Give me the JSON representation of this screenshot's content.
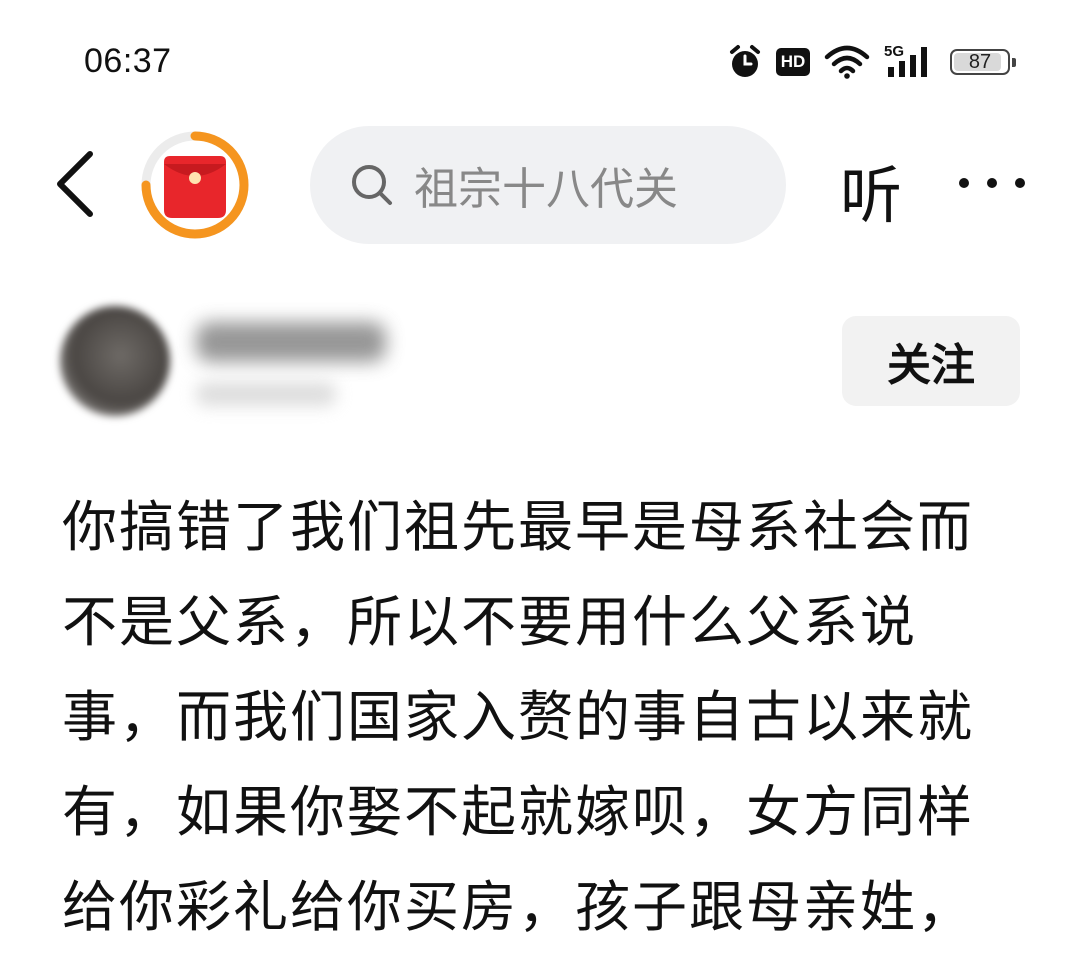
{
  "status_bar": {
    "time": "06:37",
    "icons": [
      "alarm-icon",
      "hd-icon",
      "wifi-icon",
      "signal-5g-icon",
      "battery-icon"
    ],
    "hd_label": "HD",
    "network_label": "5G",
    "battery_level": "87"
  },
  "nav": {
    "back_icon": "chevron-left-icon",
    "redpacket_icon": "red-packet-icon",
    "search_placeholder": "祖宗十八代关",
    "listen_label": "听",
    "more_icon": "more-dots-icon"
  },
  "author": {
    "follow_label": "关注"
  },
  "post": {
    "lines": [
      "你搞错了我们祖先最早是母系社会而",
      "不是父系，所以不要用什么父系说",
      "事，而我们国家入赘的事自古以来就",
      "有，如果你娶不起就嫁呗，女方同样",
      "给你彩礼给你买房，孩子跟母亲姓，"
    ]
  },
  "colors": {
    "accent_orange": "#f5951f",
    "red_packet": "#e8262b",
    "search_bg": "#f0f1f3",
    "follow_bg": "#f2f2f2"
  }
}
